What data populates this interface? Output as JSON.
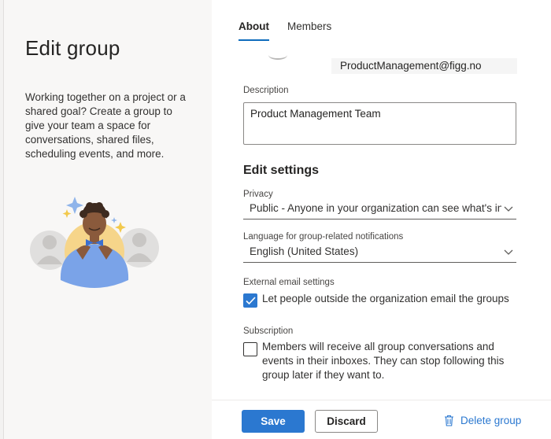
{
  "left": {
    "title": "Edit group",
    "description": "Working together on a project or a shared goal? Create a group to give your team a space for conversations, shared files, scheduling events, and more."
  },
  "tabs": [
    {
      "label": "About",
      "active": true
    },
    {
      "label": "Members",
      "active": false
    }
  ],
  "group": {
    "email": "ProductManagement@figg.no"
  },
  "description_field": {
    "label": "Description",
    "value": "Product Management Team"
  },
  "settings": {
    "title": "Edit settings",
    "privacy": {
      "label": "Privacy",
      "value": "Public - Anyone in your organization can see what's ins..."
    },
    "language": {
      "label": "Language for group-related notifications",
      "value": "English (United States)"
    },
    "external_email": {
      "label": "External email settings",
      "checkbox_label": "Let people outside the organization email the groups",
      "checked": true
    },
    "subscription": {
      "label": "Subscription",
      "checkbox_label": "Members will receive all group conversations and events in their inboxes. They can stop following this group later if they want to.",
      "checked": false
    }
  },
  "footer": {
    "save_label": "Save",
    "discard_label": "Discard",
    "delete_label": "Delete group"
  },
  "colors": {
    "accent": "#2b78d0",
    "tab_underline": "#0f6cbd"
  },
  "icons": [
    "chevron-down-icon",
    "checkmark-icon",
    "trash-icon",
    "person-illustration"
  ]
}
